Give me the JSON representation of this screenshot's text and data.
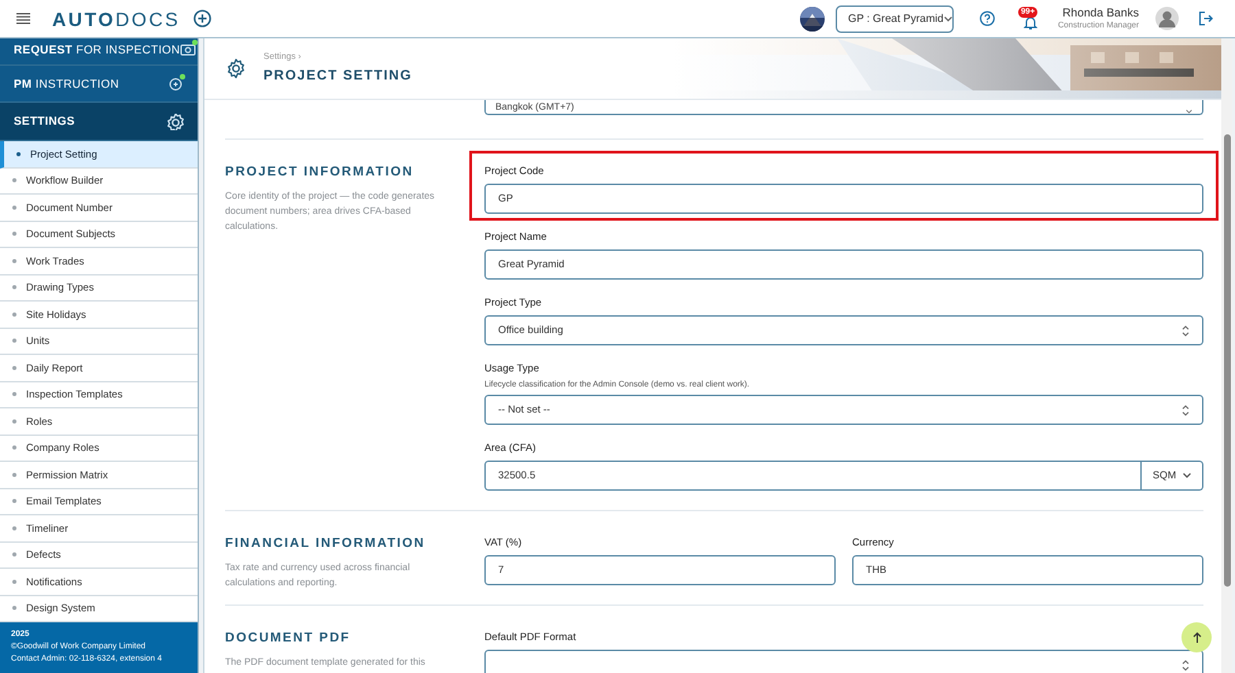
{
  "topbar": {
    "brand_bold": "AUTO",
    "brand_light": "DOCS",
    "project_select": "GP : Great Pyramid",
    "notification_badge": "99+",
    "user_name": "Rhonda Banks",
    "user_role": "Construction Manager"
  },
  "sidebar": {
    "modules": [
      {
        "kind": "camera",
        "label": "**REQUEST** FOR INSPECTION",
        "notification": true,
        "selected": false
      },
      {
        "kind": "instruction",
        "label": "**PM** INSTRUCTION",
        "notification": true,
        "selected": false
      },
      {
        "kind": "settings",
        "label": "**SETTINGS**",
        "notification": false,
        "selected": true
      }
    ],
    "items": [
      {
        "label": "Project Setting",
        "selected": true
      },
      {
        "label": "Workflow Builder",
        "selected": false
      },
      {
        "label": "Document Number",
        "selected": false
      },
      {
        "label": "Document Subjects",
        "selected": false
      },
      {
        "label": "Work Trades",
        "selected": false
      },
      {
        "label": "Drawing Types",
        "selected": false
      },
      {
        "label": "Site Holidays",
        "selected": false
      },
      {
        "label": "Units",
        "selected": false
      },
      {
        "label": "Daily Report",
        "selected": false
      },
      {
        "label": "Inspection Templates",
        "selected": false
      },
      {
        "label": "Roles",
        "selected": false
      },
      {
        "label": "Company Roles",
        "selected": false
      },
      {
        "label": "Permission Matrix",
        "selected": false
      },
      {
        "label": "Email Templates",
        "selected": false
      },
      {
        "label": "Timeliner",
        "selected": false
      },
      {
        "label": "Defects",
        "selected": false
      },
      {
        "label": "Notifications",
        "selected": false
      },
      {
        "label": "Design System",
        "selected": false
      }
    ],
    "footer": {
      "year": "2025",
      "copyright": "©Goodwill of Work Company Limited",
      "contact": "Contact Admin: 02-118-6324, extension 4"
    }
  },
  "page_header": {
    "breadcrumb": "Settings ›",
    "title": "PROJECT SETTING"
  },
  "content": {
    "partial_field_value": "Bangkok (GMT+7)",
    "sections": [
      {
        "title": "PROJECT INFORMATION",
        "description": "Core identity of the project — the code generates document numbers; area drives CFA-based calculations.",
        "fields": [
          {
            "kind": "text",
            "label": "Project Code",
            "value": "GP",
            "highlighted": true
          },
          {
            "kind": "text",
            "label": "Project Name",
            "value": "Great Pyramid",
            "highlighted": false
          },
          {
            "kind": "select",
            "label": "Project Type",
            "value": "Office building",
            "highlighted": false
          },
          {
            "kind": "select",
            "label": "Usage Type",
            "hint": "Lifecycle classification for the Admin Console (demo vs. real client work).",
            "value": "-- Not set --",
            "highlighted": false
          },
          {
            "kind": "unit",
            "label": "Area (CFA)",
            "value": "32500.5",
            "unit": "SQM",
            "highlighted": false
          }
        ]
      },
      {
        "title": "FINANCIAL INFORMATION",
        "description": "Tax rate and currency used across financial calculations and reporting.",
        "fields": [
          {
            "kind": "text",
            "label": "VAT (%)",
            "value": "7",
            "highlighted": false
          },
          {
            "kind": "text",
            "label": "Currency",
            "value": "THB",
            "highlighted": false
          }
        ]
      },
      {
        "title": "DOCUMENT PDF",
        "description": "The PDF document template generated for this",
        "fields": [
          {
            "kind": "select",
            "label": "Default PDF Format",
            "highlighted": false
          }
        ]
      }
    ]
  }
}
